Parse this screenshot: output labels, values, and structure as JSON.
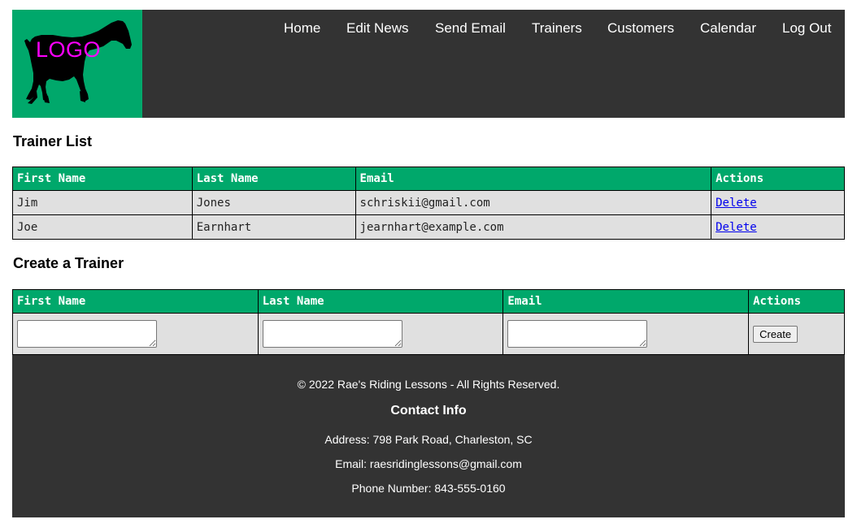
{
  "logo": {
    "text": "LOGO",
    "icon": "horse-icon"
  },
  "nav": {
    "items": [
      {
        "label": "Home"
      },
      {
        "label": "Edit News"
      },
      {
        "label": "Send Email"
      },
      {
        "label": "Trainers"
      },
      {
        "label": "Customers"
      },
      {
        "label": "Calendar"
      },
      {
        "label": "Log Out"
      }
    ]
  },
  "trainer_list": {
    "title": "Trainer List",
    "headers": [
      "First Name",
      "Last Name",
      "Email",
      "Actions"
    ],
    "rows": [
      {
        "first": "Jim",
        "last": "Jones",
        "email": "schriskii@gmail.com",
        "action": "Delete"
      },
      {
        "first": "Joe",
        "last": "Earnhart",
        "email": "jearnhart@example.com",
        "action": "Delete"
      }
    ]
  },
  "create_trainer": {
    "title": "Create a Trainer",
    "headers": [
      "First Name",
      "Last Name",
      "Email",
      "Actions"
    ],
    "first_value": "",
    "last_value": "",
    "email_value": "",
    "button_label": "Create"
  },
  "footer": {
    "copyright": "© 2022 Rae's Riding Lessons - All Rights Reserved.",
    "contact_title": "Contact Info",
    "address": "Address:  798 Park Road, Charleston, SC",
    "email": "Email:  raesridinglessons@gmail.com",
    "phone": "Phone Number:  843-555-0160"
  },
  "colors": {
    "brand_green": "#00a86b",
    "dark_bg": "#333333",
    "logo_text": "#ff00ff"
  }
}
